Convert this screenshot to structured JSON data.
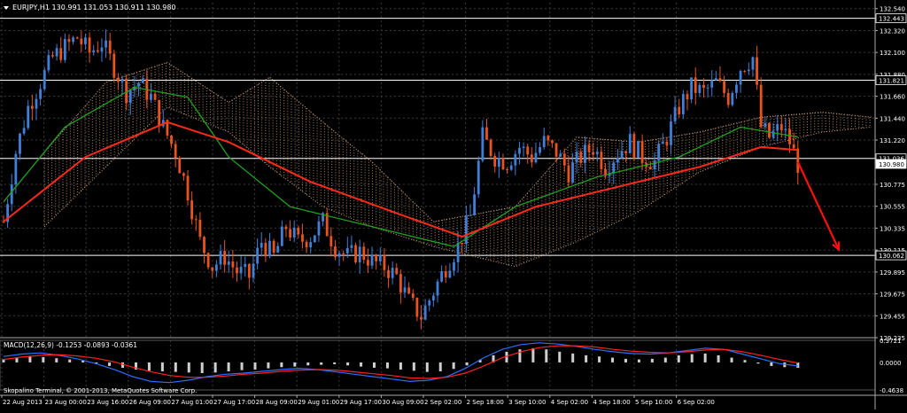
{
  "header": {
    "symbol_line": "EURJPY,H1  130.991 131.053 130.911 130.980"
  },
  "macd_header": "MACD(12,26,9) -0.1253 -0.0893 -0.0361",
  "copyright": "Skopalino Terminal, © 2001-2013, MetaQuotes Software Corp.",
  "colors": {
    "background": "#000000",
    "grid": "#3a3a3a",
    "bull_candle": "#3f7fd8",
    "bear_candle": "#e8541c",
    "ma_red": "#ff2a1a",
    "ma_green": "#1fa21f",
    "cloud": "#d9a77a",
    "macd_hist": "#cfcfcf",
    "macd_main": "#2a6fff",
    "macd_signal": "#ff2020",
    "horizontal_line": "#ffffff",
    "arrow": "#ff1010"
  },
  "chart_data": {
    "type": "candlestick",
    "title": "EURJPY,H1",
    "ohlc_last": {
      "open": 130.991,
      "high": 131.053,
      "low": 130.911,
      "close": 130.98
    },
    "ylim": [
      129.235,
      132.6
    ],
    "y_ticks": [
      "132.540",
      "132.320",
      "132.100",
      "131.880",
      "131.660",
      "131.440",
      "131.220",
      "130.775",
      "130.555",
      "130.335",
      "130.115",
      "129.895",
      "129.675",
      "129.455",
      "129.235"
    ],
    "x_ticks": [
      "22 Aug 2013",
      "23 Aug 00:00",
      "23 Aug 16:00",
      "26 Aug 09:00",
      "27 Aug 01:00",
      "27 Aug 17:00",
      "28 Aug 09:00",
      "29 Aug 01:00",
      "29 Aug 17:00",
      "30 Aug 09:00",
      "2 Sep 02:00",
      "2 Sep 18:00",
      "3 Sep 10:00",
      "4 Sep 02:00",
      "4 Sep 18:00",
      "5 Sep 10:00",
      "6 Sep 02:00"
    ],
    "horizontal_levels": [
      {
        "value": 132.443,
        "label": "132.443"
      },
      {
        "value": 131.821,
        "label": "131.821"
      },
      {
        "value": 131.036,
        "label": "131.036"
      },
      {
        "value": 130.062,
        "label": "130.062"
      }
    ],
    "current_price": {
      "value": 130.98,
      "label": "130.980"
    },
    "close_path": [
      {
        "t": 0,
        "c": 130.4
      },
      {
        "t": 3,
        "c": 131.1
      },
      {
        "t": 6,
        "c": 131.55
      },
      {
        "t": 9,
        "c": 131.8
      },
      {
        "t": 12,
        "c": 132.05
      },
      {
        "t": 15,
        "c": 132.15
      },
      {
        "t": 18,
        "c": 132.25
      },
      {
        "t": 21,
        "c": 132.1
      },
      {
        "t": 24,
        "c": 132.2
      },
      {
        "t": 27,
        "c": 131.95
      },
      {
        "t": 30,
        "c": 131.7
      },
      {
        "t": 33,
        "c": 131.8
      },
      {
        "t": 36,
        "c": 131.65
      },
      {
        "t": 39,
        "c": 131.35
      },
      {
        "t": 42,
        "c": 131.1
      },
      {
        "t": 45,
        "c": 130.7
      },
      {
        "t": 48,
        "c": 130.2
      },
      {
        "t": 51,
        "c": 129.95
      },
      {
        "t": 54,
        "c": 130.05
      },
      {
        "t": 57,
        "c": 129.9
      },
      {
        "t": 60,
        "c": 129.85
      },
      {
        "t": 63,
        "c": 130.2
      },
      {
        "t": 66,
        "c": 130.05
      },
      {
        "t": 69,
        "c": 130.35
      },
      {
        "t": 72,
        "c": 130.2
      },
      {
        "t": 75,
        "c": 130.25
      },
      {
        "t": 78,
        "c": 130.4
      },
      {
        "t": 81,
        "c": 130.15
      },
      {
        "t": 84,
        "c": 130.05
      },
      {
        "t": 87,
        "c": 130.1
      },
      {
        "t": 90,
        "c": 130.0
      },
      {
        "t": 93,
        "c": 129.95
      },
      {
        "t": 96,
        "c": 129.85
      },
      {
        "t": 99,
        "c": 129.6
      },
      {
        "t": 102,
        "c": 129.45
      },
      {
        "t": 105,
        "c": 129.7
      },
      {
        "t": 108,
        "c": 129.95
      },
      {
        "t": 111,
        "c": 130.15
      },
      {
        "t": 114,
        "c": 130.45
      },
      {
        "t": 117,
        "c": 131.25
      },
      {
        "t": 120,
        "c": 131.05
      },
      {
        "t": 123,
        "c": 131.0
      },
      {
        "t": 126,
        "c": 131.15
      },
      {
        "t": 129,
        "c": 131.05
      },
      {
        "t": 132,
        "c": 131.2
      },
      {
        "t": 135,
        "c": 131.1
      },
      {
        "t": 138,
        "c": 130.9
      },
      {
        "t": 141,
        "c": 131.05
      },
      {
        "t": 144,
        "c": 131.15
      },
      {
        "t": 147,
        "c": 130.95
      },
      {
        "t": 150,
        "c": 131.1
      },
      {
        "t": 153,
        "c": 131.2
      },
      {
        "t": 156,
        "c": 131.05
      },
      {
        "t": 159,
        "c": 131.0
      },
      {
        "t": 162,
        "c": 131.25
      },
      {
        "t": 165,
        "c": 131.55
      },
      {
        "t": 168,
        "c": 131.75
      },
      {
        "t": 171,
        "c": 131.7
      },
      {
        "t": 174,
        "c": 131.8
      },
      {
        "t": 177,
        "c": 131.65
      },
      {
        "t": 180,
        "c": 131.95
      },
      {
        "t": 183,
        "c": 132.05
      },
      {
        "t": 185,
        "c": 131.35
      },
      {
        "t": 187,
        "c": 131.25
      },
      {
        "t": 190,
        "c": 131.35
      },
      {
        "t": 192,
        "c": 131.2
      },
      {
        "t": 194,
        "c": 130.98
      }
    ],
    "ma_red": [
      {
        "t": 0,
        "v": 130.4
      },
      {
        "t": 20,
        "v": 131.05
      },
      {
        "t": 40,
        "v": 131.4
      },
      {
        "t": 55,
        "v": 131.2
      },
      {
        "t": 75,
        "v": 130.8
      },
      {
        "t": 95,
        "v": 130.5
      },
      {
        "t": 112,
        "v": 130.25
      },
      {
        "t": 130,
        "v": 130.55
      },
      {
        "t": 150,
        "v": 130.75
      },
      {
        "t": 170,
        "v": 130.95
      },
      {
        "t": 185,
        "v": 131.15
      },
      {
        "t": 194,
        "v": 131.12
      }
    ],
    "ma_green": [
      {
        "t": 0,
        "v": 130.6
      },
      {
        "t": 15,
        "v": 131.35
      },
      {
        "t": 32,
        "v": 131.75
      },
      {
        "t": 45,
        "v": 131.65
      },
      {
        "t": 55,
        "v": 131.05
      },
      {
        "t": 70,
        "v": 130.55
      },
      {
        "t": 90,
        "v": 130.35
      },
      {
        "t": 110,
        "v": 130.15
      },
      {
        "t": 125,
        "v": 130.55
      },
      {
        "t": 145,
        "v": 130.85
      },
      {
        "t": 165,
        "v": 131.05
      },
      {
        "t": 180,
        "v": 131.35
      },
      {
        "t": 194,
        "v": 131.25
      }
    ],
    "cloud_upper": [
      {
        "t": 10,
        "v": 131.1
      },
      {
        "t": 25,
        "v": 131.8
      },
      {
        "t": 40,
        "v": 132.0
      },
      {
        "t": 55,
        "v": 131.6
      },
      {
        "t": 65,
        "v": 131.85
      },
      {
        "t": 78,
        "v": 131.4
      },
      {
        "t": 90,
        "v": 131.0
      },
      {
        "t": 105,
        "v": 130.4
      },
      {
        "t": 125,
        "v": 130.55
      },
      {
        "t": 140,
        "v": 131.25
      },
      {
        "t": 155,
        "v": 131.2
      },
      {
        "t": 170,
        "v": 131.3
      },
      {
        "t": 185,
        "v": 131.45
      },
      {
        "t": 200,
        "v": 131.5
      },
      {
        "t": 212,
        "v": 131.45
      }
    ],
    "cloud_lower": [
      {
        "t": 10,
        "v": 130.35
      },
      {
        "t": 25,
        "v": 130.95
      },
      {
        "t": 40,
        "v": 131.55
      },
      {
        "t": 55,
        "v": 131.3
      },
      {
        "t": 65,
        "v": 130.95
      },
      {
        "t": 78,
        "v": 130.55
      },
      {
        "t": 90,
        "v": 130.35
      },
      {
        "t": 105,
        "v": 130.15
      },
      {
        "t": 125,
        "v": 129.95
      },
      {
        "t": 140,
        "v": 130.2
      },
      {
        "t": 155,
        "v": 130.5
      },
      {
        "t": 170,
        "v": 130.9
      },
      {
        "t": 185,
        "v": 131.15
      },
      {
        "t": 200,
        "v": 131.3
      },
      {
        "t": 212,
        "v": 131.35
      }
    ],
    "forecast_arrow": {
      "from": {
        "t": 194,
        "v": 131.0
      },
      "to": {
        "t": 204,
        "v": 130.12
      }
    },
    "macd": {
      "ylim": [
        -0.4638,
        0.3721
      ],
      "y_ticks": [
        "0.3721",
        "0.0000",
        "-0.4638"
      ],
      "hist": [
        0.05,
        0.08,
        0.1,
        0.09,
        0.07,
        0.05,
        0.03,
        -0.02,
        -0.06,
        -0.09,
        -0.12,
        -0.14,
        -0.15,
        -0.16,
        -0.17,
        -0.18,
        -0.17,
        -0.15,
        -0.13,
        -0.12,
        -0.1,
        -0.08,
        -0.07,
        -0.05,
        -0.04,
        -0.03,
        -0.05,
        -0.07,
        -0.09,
        -0.1,
        -0.12,
        -0.14,
        -0.16,
        -0.15,
        -0.11,
        -0.05,
        0.05,
        0.12,
        0.18,
        0.22,
        0.24,
        0.22,
        0.18,
        0.15,
        0.12,
        0.1,
        0.08,
        0.06,
        0.05,
        0.06,
        0.08,
        0.12,
        0.14,
        0.15,
        0.12,
        0.08,
        0.04,
        -0.02,
        -0.06,
        -0.08,
        -0.09
      ],
      "main": [
        0.1,
        0.14,
        0.16,
        0.12,
        0.06,
        -0.02,
        -0.12,
        -0.24,
        -0.32,
        -0.34,
        -0.3,
        -0.24,
        -0.2,
        -0.18,
        -0.15,
        -0.12,
        -0.1,
        -0.12,
        -0.16,
        -0.2,
        -0.24,
        -0.28,
        -0.32,
        -0.3,
        -0.24,
        -0.1,
        0.08,
        0.22,
        0.3,
        0.33,
        0.31,
        0.27,
        0.22,
        0.18,
        0.15,
        0.14,
        0.16,
        0.2,
        0.24,
        0.22,
        0.14,
        0.06,
        -0.02,
        -0.06
      ],
      "signal": [
        0.05,
        0.09,
        0.12,
        0.13,
        0.11,
        0.07,
        0.01,
        -0.08,
        -0.16,
        -0.22,
        -0.25,
        -0.25,
        -0.23,
        -0.2,
        -0.18,
        -0.15,
        -0.13,
        -0.12,
        -0.13,
        -0.16,
        -0.19,
        -0.22,
        -0.26,
        -0.27,
        -0.25,
        -0.18,
        -0.06,
        0.08,
        0.18,
        0.25,
        0.28,
        0.28,
        0.26,
        0.22,
        0.19,
        0.17,
        0.16,
        0.18,
        0.21,
        0.22,
        0.18,
        0.12,
        0.05,
        -0.01
      ]
    }
  }
}
